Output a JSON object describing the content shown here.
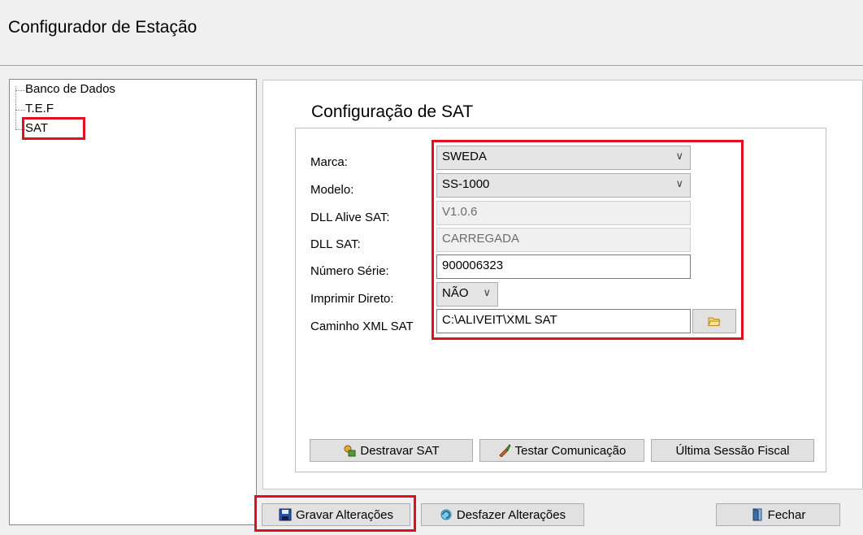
{
  "window": {
    "title": "Configurador de Estação"
  },
  "tree": {
    "items": [
      {
        "label": "Banco de Dados"
      },
      {
        "label": "T.E.F"
      },
      {
        "label": "SAT"
      }
    ]
  },
  "panel": {
    "heading": "Configuração de SAT",
    "fields": {
      "marca": {
        "label": "Marca:",
        "value": "SWEDA"
      },
      "modelo": {
        "label": "Modelo:",
        "value": "SS-1000"
      },
      "dll_alive": {
        "label": "DLL Alive SAT:",
        "value": "V1.0.6"
      },
      "dll_sat": {
        "label": "DLL SAT:",
        "value": "CARREGADA"
      },
      "numero_serie": {
        "label": "Número Série:",
        "value": "900006323"
      },
      "imprimir_direto": {
        "label": "Imprimir Direto:",
        "value": "NÃO"
      },
      "caminho_xml": {
        "label": "Caminho XML SAT",
        "value": "C:\\ALIVEIT\\XML SAT"
      }
    },
    "buttons": {
      "destravar": "Destravar SAT",
      "testar": "Testar Comunicação",
      "ultima": "Última Sessão Fiscal"
    }
  },
  "footer": {
    "gravar": "Gravar Alterações",
    "desfazer": "Desfazer Alterações",
    "fechar": "Fechar"
  },
  "colors": {
    "highlight": "#e0101e",
    "window_bg": "#f0f0f0",
    "button_bg": "#e1e1e1"
  },
  "icons": [
    "folder-icon",
    "unlock-icon",
    "test-icon",
    "save-icon",
    "undo-icon",
    "exit-door-icon"
  ]
}
